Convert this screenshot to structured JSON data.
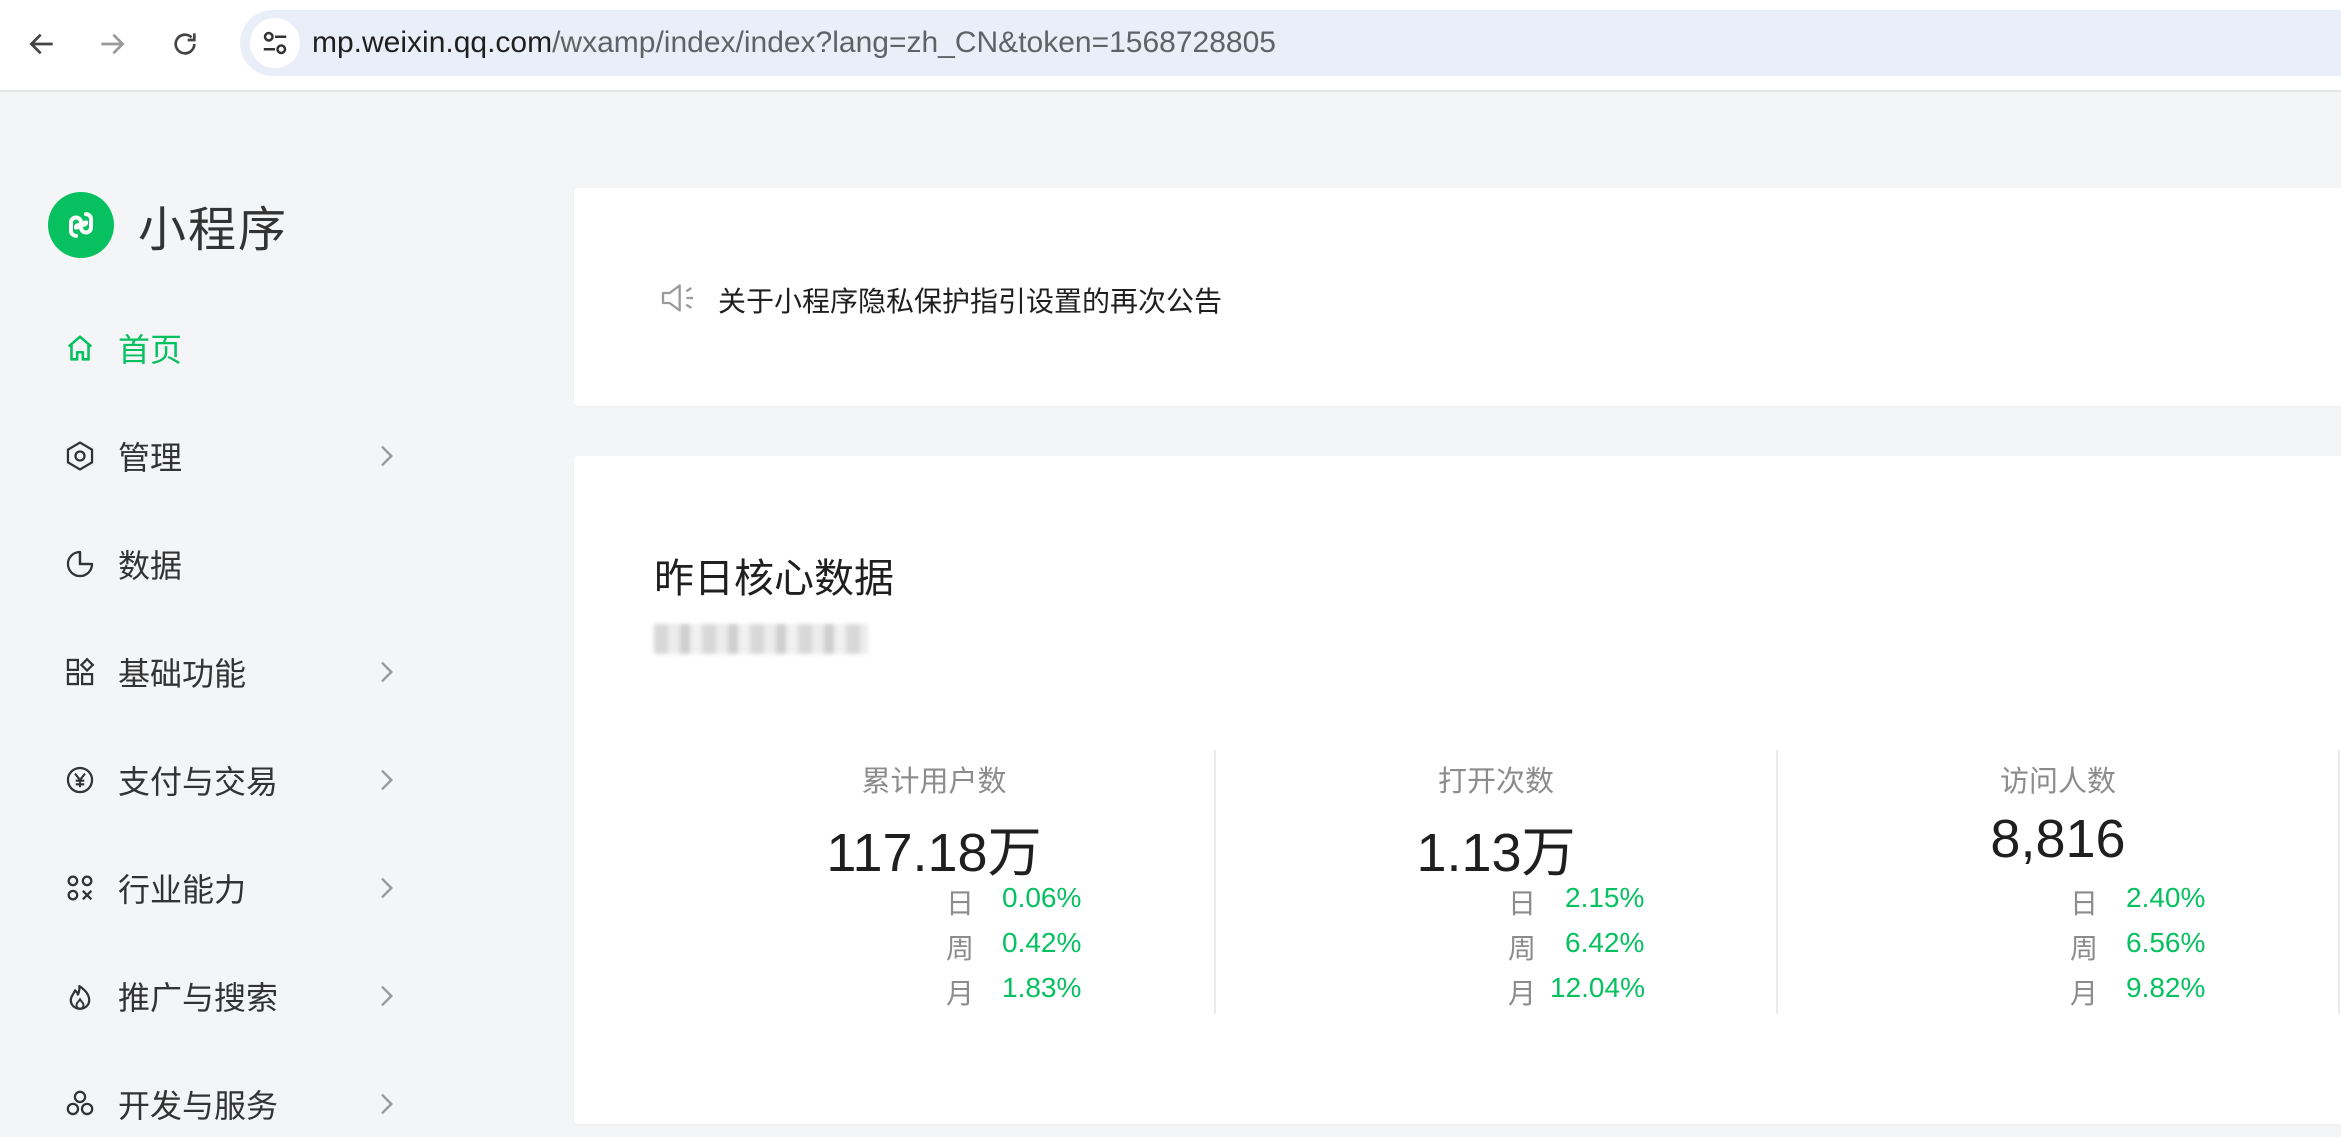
{
  "browser": {
    "url_host": "mp.weixin.qq.com",
    "url_path": "/wxamp/index/index?lang=zh_CN&token=1568728805"
  },
  "sidebar": {
    "brand": "小程序",
    "items": [
      {
        "label": "首页",
        "icon": "home-icon",
        "active": true,
        "has_arrow": false
      },
      {
        "label": "管理",
        "icon": "hexagon-settings-icon",
        "active": false,
        "has_arrow": true
      },
      {
        "label": "数据",
        "icon": "pie-chart-icon",
        "active": false,
        "has_arrow": false
      },
      {
        "label": "基础功能",
        "icon": "grid-apps-icon",
        "active": false,
        "has_arrow": true
      },
      {
        "label": "支付与交易",
        "icon": "yuan-icon",
        "active": false,
        "has_arrow": true
      },
      {
        "label": "行业能力",
        "icon": "nodes-icon",
        "active": false,
        "has_arrow": true
      },
      {
        "label": "推广与搜索",
        "icon": "flame-icon",
        "active": false,
        "has_arrow": true
      },
      {
        "label": "开发与服务",
        "icon": "clover-icon",
        "active": false,
        "has_arrow": true
      }
    ]
  },
  "notice": {
    "text": "关于小程序隐私保护指引设置的再次公告"
  },
  "core_data": {
    "title": "昨日核心数据",
    "metrics": [
      {
        "label": "累计用户数",
        "value": "117.18万",
        "rows": [
          {
            "label": "日",
            "value": "0.06%"
          },
          {
            "label": "周",
            "value": "0.42%"
          },
          {
            "label": "月",
            "value": "1.83%"
          }
        ]
      },
      {
        "label": "打开次数",
        "value": "1.13万",
        "rows": [
          {
            "label": "日",
            "value": "2.15%"
          },
          {
            "label": "周",
            "value": "6.42%"
          },
          {
            "label": "月",
            "value": "12.04%"
          }
        ]
      },
      {
        "label": "访问人数",
        "value": "8,816",
        "rows": [
          {
            "label": "日",
            "value": "2.40%"
          },
          {
            "label": "周",
            "value": "6.56%"
          },
          {
            "label": "月",
            "value": "9.82%"
          }
        ]
      }
    ]
  },
  "colors": {
    "accent": "#07c160",
    "text": "#1f1f1f",
    "muted": "#8c8c8c"
  }
}
